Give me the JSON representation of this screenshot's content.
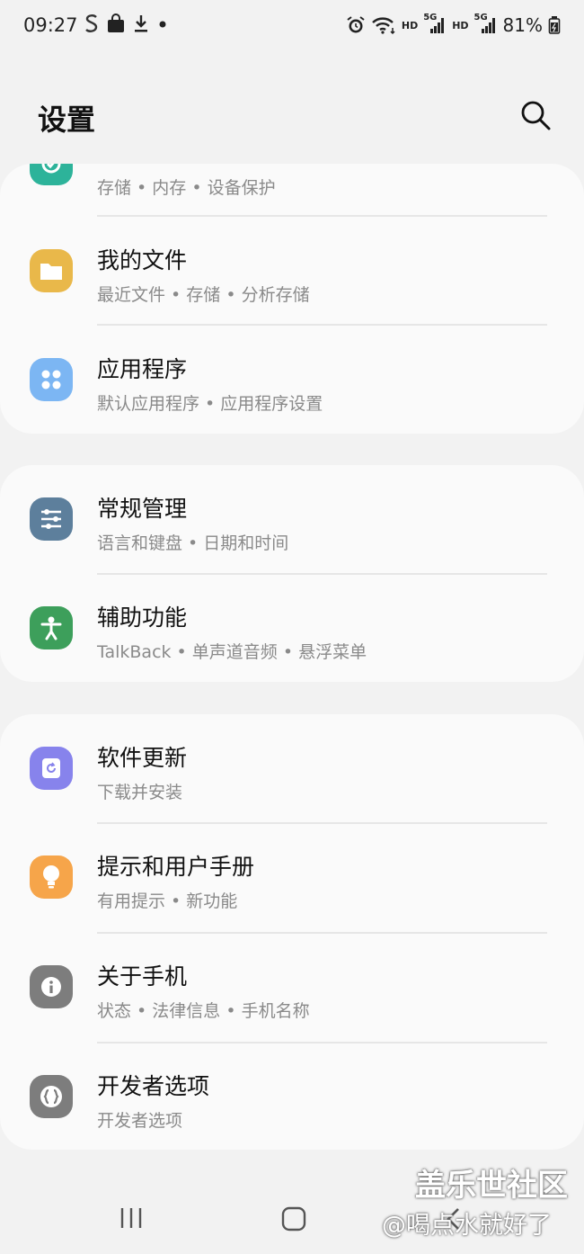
{
  "status_bar": {
    "time": "09:27",
    "left_icons": [
      "samsung-s-icon",
      "shopping-bag-icon",
      "download-icon",
      "dot-icon"
    ],
    "right_icons": [
      "alarm-icon",
      "wifi-icon",
      "hd-icon",
      "signal-5g-icon",
      "hd-icon",
      "signal-5g-icon",
      "battery-icon"
    ],
    "hd_label": "HD",
    "net_label": "5G",
    "battery": "81%"
  },
  "header": {
    "title": "设置"
  },
  "cards": [
    {
      "items": [
        {
          "title": "",
          "subtitle": "存储 • 内存 • 设备保护",
          "icon": "device-care-icon",
          "color": "#2db39a"
        },
        {
          "title": "我的文件",
          "subtitle": "最近文件 • 存储 • 分析存储",
          "icon": "folder-icon",
          "color": "#e9b84a"
        },
        {
          "title": "应用程序",
          "subtitle": "默认应用程序 • 应用程序设置",
          "icon": "apps-icon",
          "color": "#7cb6f3"
        }
      ]
    },
    {
      "items": [
        {
          "title": "常规管理",
          "subtitle": "语言和键盘 • 日期和时间",
          "icon": "sliders-icon",
          "color": "#5d7f9c"
        },
        {
          "title": "辅助功能",
          "subtitle": "TalkBack • 单声道音频 • 悬浮菜单",
          "icon": "accessibility-icon",
          "color": "#3d9f5b"
        }
      ]
    },
    {
      "items": [
        {
          "title": "软件更新",
          "subtitle": "下载并安装",
          "icon": "software-update-icon",
          "color": "#8783ec"
        },
        {
          "title": "提示和用户手册",
          "subtitle": "有用提示 • 新功能",
          "icon": "lightbulb-icon",
          "color": "#f6a54a"
        },
        {
          "title": "关于手机",
          "subtitle": "状态 • 法律信息 • 手机名称",
          "icon": "info-icon",
          "color": "#7d7d7d"
        },
        {
          "title": "开发者选项",
          "subtitle": "开发者选项",
          "icon": "developer-braces-icon",
          "color": "#7d7d7d"
        }
      ]
    }
  ],
  "nav_bar": {
    "buttons": [
      "recents-icon",
      "home-icon",
      "back-icon"
    ]
  },
  "watermark": {
    "line1": "盖乐世社区",
    "line2": "@喝点水就好了"
  }
}
